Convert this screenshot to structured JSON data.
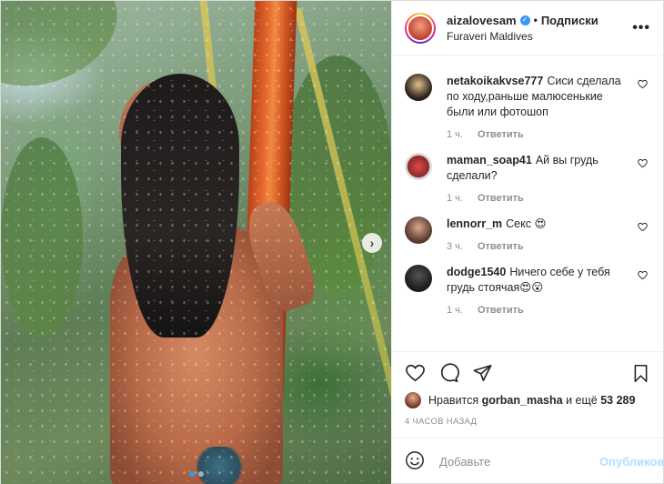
{
  "header": {
    "username": "aizalovesam",
    "separator": "•",
    "follow_label": "Подписки",
    "location": "Furaveri Maldives",
    "more_label": "•••"
  },
  "carousel": {
    "next_label": "›",
    "slide_count": 2,
    "active_slide": 1
  },
  "comments": [
    {
      "username": "netakoikakvse777",
      "text": "Сиси сделала по ходу,раньше малюсенькие были или фотошоп",
      "time": "1 ч.",
      "reply_label": "Ответить",
      "avatar_color": "#2a1f1a"
    },
    {
      "username": "maman_soap41",
      "text": "Ай вы грудь сделали?",
      "time": "1 ч.",
      "reply_label": "Ответить",
      "avatar_color": "#b83a3a"
    },
    {
      "username": "lennorr_m",
      "text": "Секс 😍",
      "time": "3 ч.",
      "reply_label": "Ответить",
      "avatar_color": "#7a5a4a"
    },
    {
      "username": "dodge1540",
      "text": "Ничего себе у тебя грудь стоячая😍😮",
      "time": "1 ч.",
      "reply_label": "Ответить",
      "avatar_color": "#2b2b2b"
    }
  ],
  "likes": {
    "prefix": "Нравится",
    "user": "gorban_masha",
    "middle": "и ещё",
    "count": "53 289"
  },
  "timestamp": "4 часов назад",
  "add_comment": {
    "placeholder": "Добавьте",
    "publish_label": "Опубликовать"
  },
  "colors": {
    "verified": "#3897f0",
    "publish": "#b2dffc",
    "meta": "#8e8e8e"
  }
}
